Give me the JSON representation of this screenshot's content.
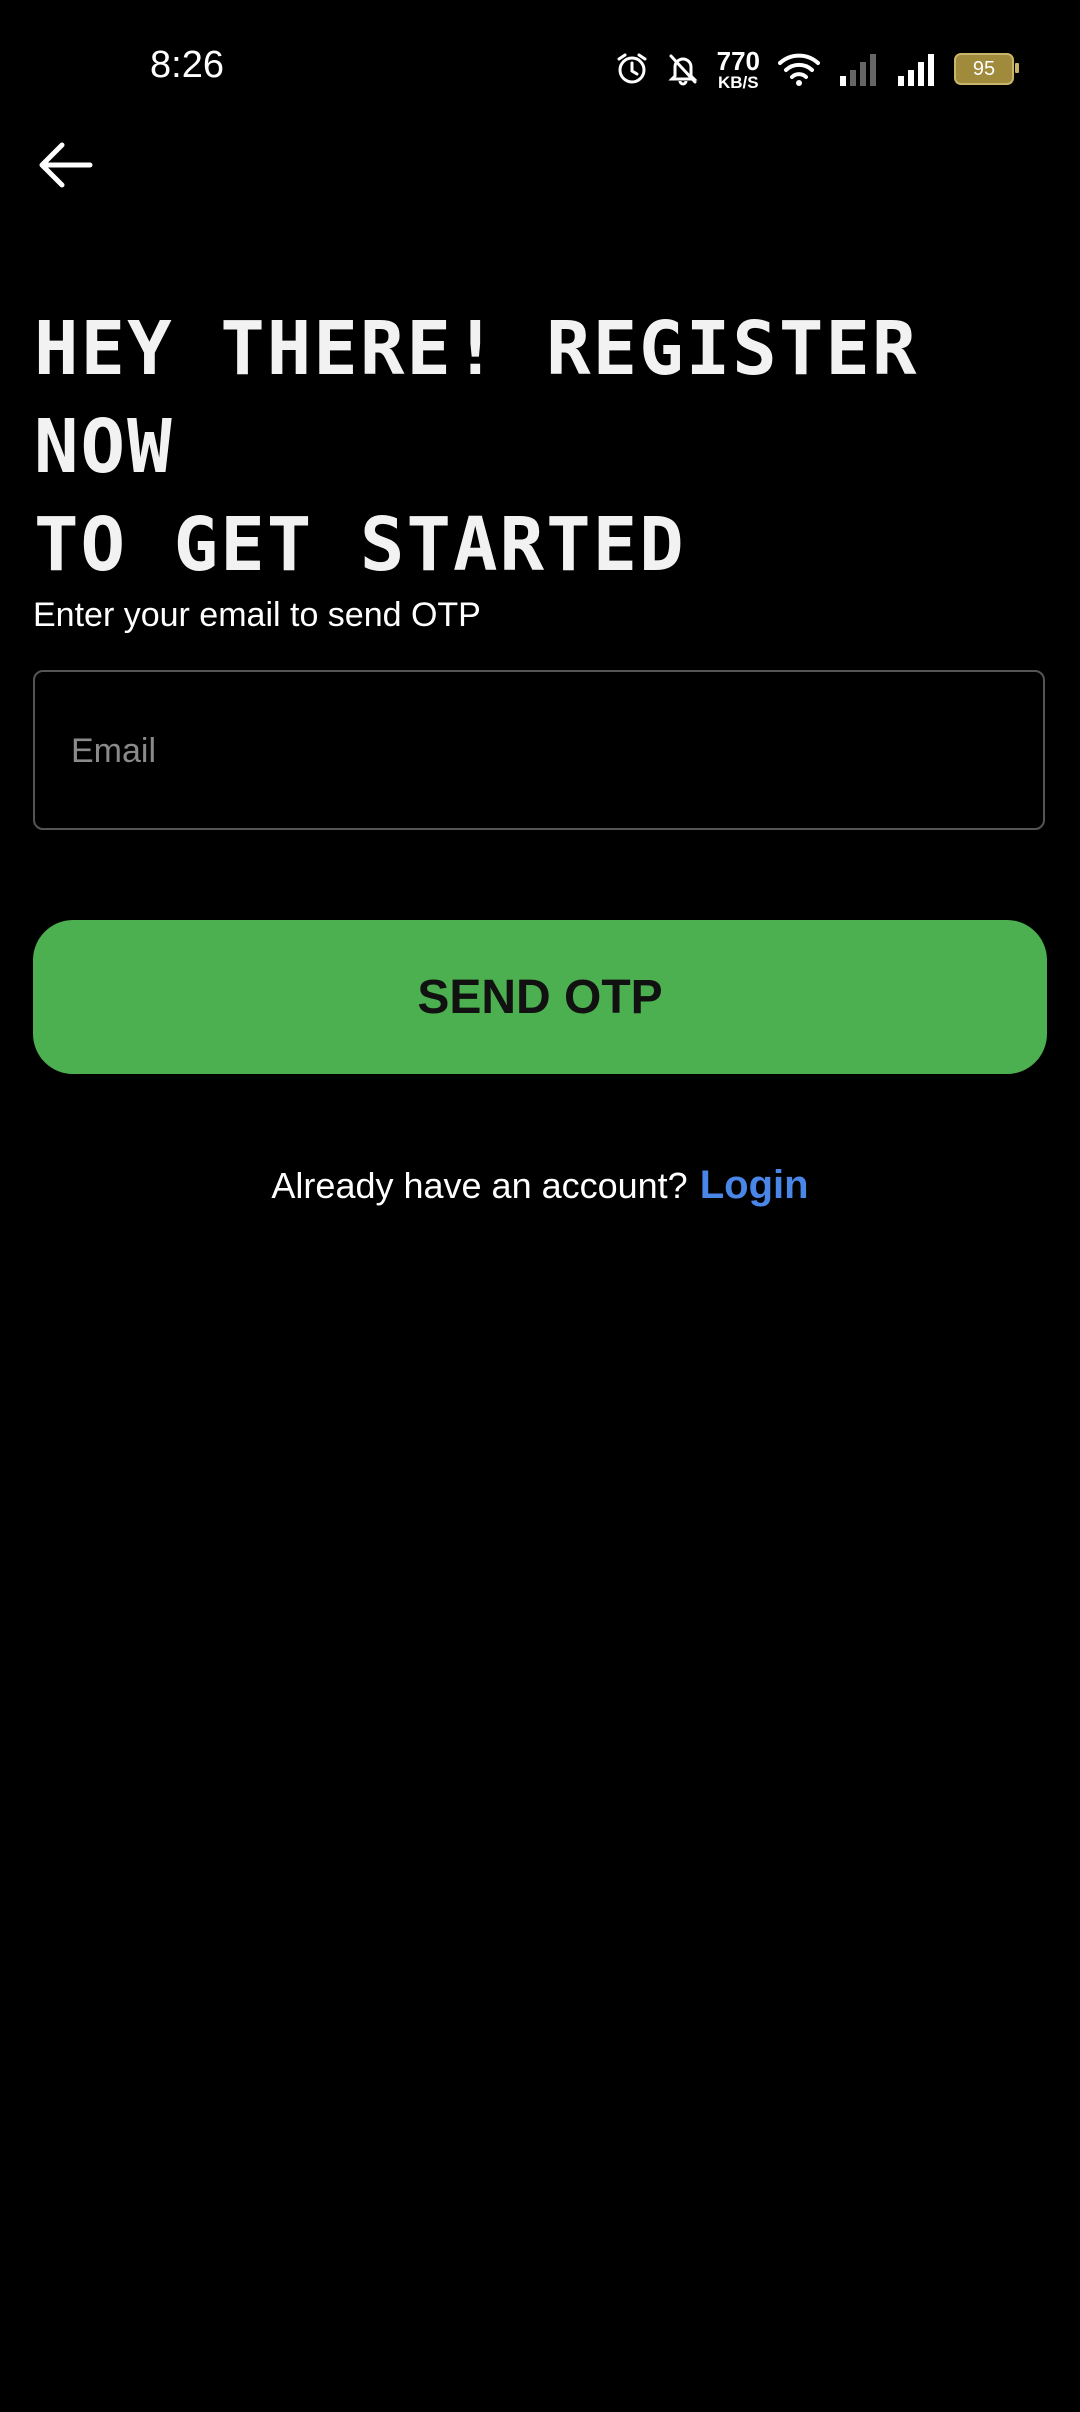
{
  "status_bar": {
    "time": "8:26",
    "net_speed_value": "770",
    "net_speed_unit": "KB/S",
    "battery_level": "95",
    "icons": [
      "alarm-icon",
      "bell-off-icon",
      "wifi-icon",
      "signal-icon",
      "signal-icon",
      "battery-icon"
    ]
  },
  "nav": {
    "back_icon": "arrow-left-icon"
  },
  "headline": {
    "line1": "HEY THERE! REGISTER NOW",
    "line2": "TO GET STARTED"
  },
  "form": {
    "label": "Enter your email to send OTP",
    "email_placeholder": "Email",
    "email_value": "",
    "submit_label": "SEND OTP"
  },
  "footer": {
    "prompt": "Already have an account?",
    "login_label": "Login"
  },
  "colors": {
    "background": "#000000",
    "accent_button": "#4caf50",
    "link": "#4a86e8"
  }
}
